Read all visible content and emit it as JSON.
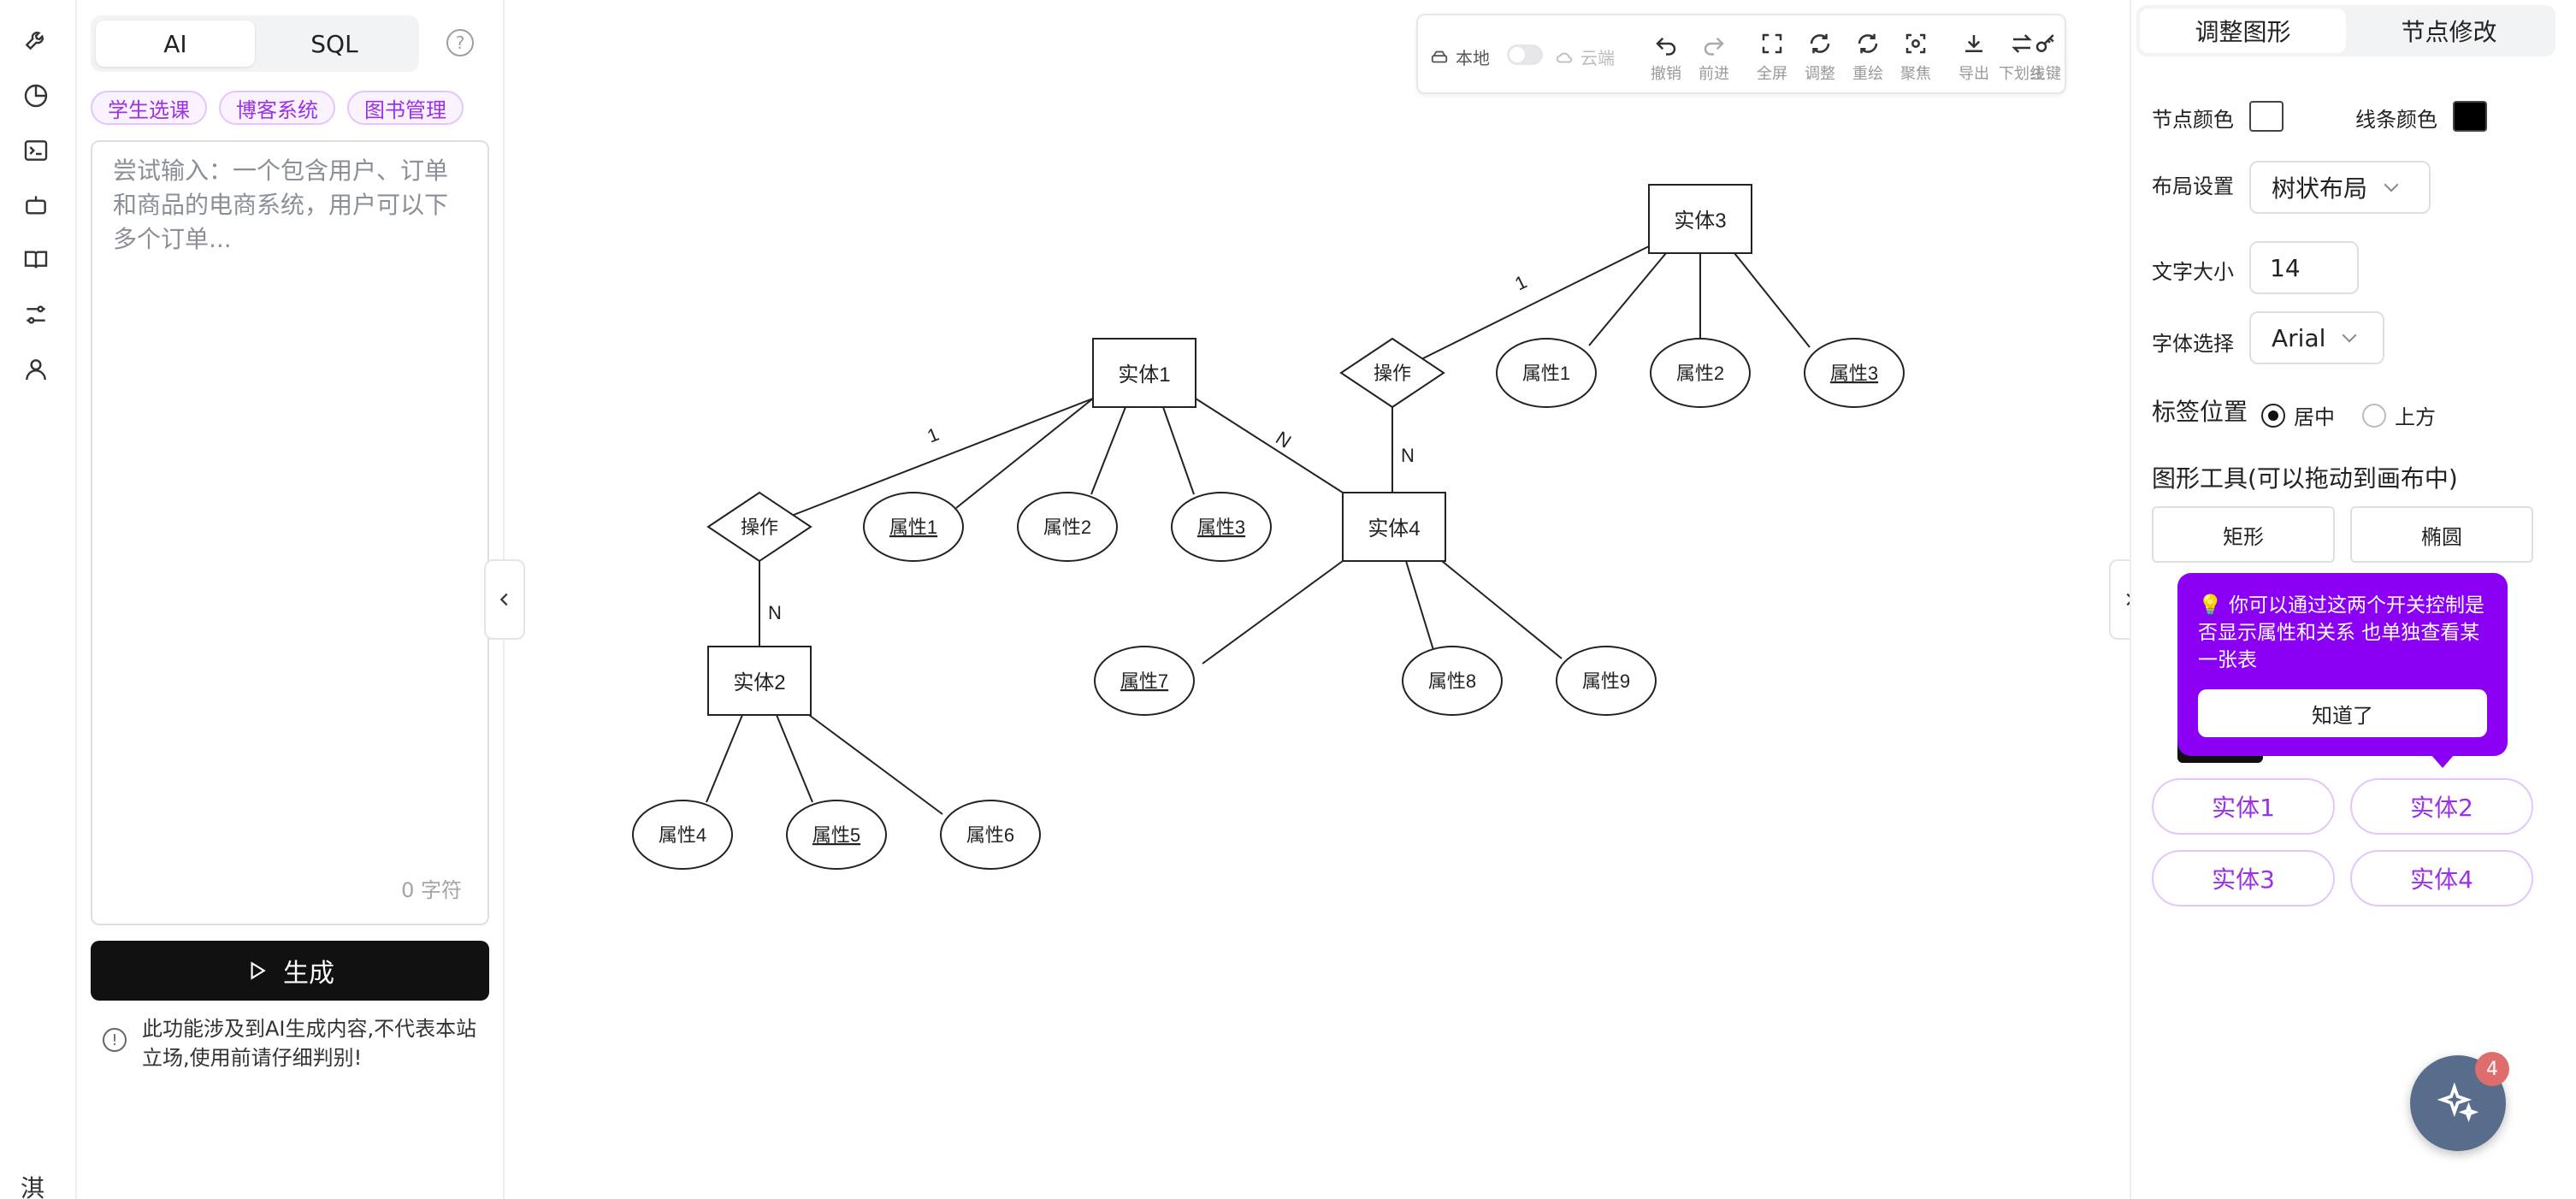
{
  "left_panel": {
    "mode_tabs": [
      {
        "label": "AI",
        "active": true
      },
      {
        "label": "SQL",
        "active": false
      }
    ],
    "help_icon": "question-circle-icon",
    "example_tags": [
      "学生选课",
      "博客系统",
      "图书管理"
    ],
    "prompt_input": {
      "value": "",
      "placeholder": "尝试输入：一个包含用户、订单和商品的电商系统，用户可以下多个订单..."
    },
    "char_count": "0 字符",
    "generate_button": "生成",
    "disclaimer": "此功能涉及到AI生成内容,不代表本站立场,使用前请仔细判别!"
  },
  "rail": {
    "icons": [
      "wrench-icon",
      "pie-chart-icon",
      "terminal-icon",
      "robot-icon",
      "book-icon",
      "settings-sliders-icon",
      "user-icon"
    ],
    "brand_char": "淇"
  },
  "toolbar": {
    "local_label": "本地",
    "cloud_label": "云端",
    "buttons": [
      {
        "label": "撤销",
        "icon": "undo-icon"
      },
      {
        "label": "前进",
        "icon": "redo-icon"
      },
      {
        "label": "全屏",
        "icon": "fullscreen-icon"
      },
      {
        "label": "调整",
        "icon": "refresh-icon"
      },
      {
        "label": "重绘",
        "icon": "redraw-icon"
      },
      {
        "label": "聚焦",
        "icon": "focus-icon"
      },
      {
        "label": "导出",
        "icon": "download-icon"
      },
      {
        "label": "下划线",
        "icon": "swap-icon"
      },
      {
        "label": "主键",
        "icon": "key-icon"
      }
    ]
  },
  "diagram": {
    "entities": [
      {
        "id": "e1",
        "label": "实体1"
      },
      {
        "id": "e2",
        "label": "实体2"
      },
      {
        "id": "e3",
        "label": "实体3"
      },
      {
        "id": "e4",
        "label": "实体4"
      }
    ],
    "relationships": [
      {
        "id": "r1",
        "label": "操作"
      },
      {
        "id": "r2",
        "label": "操作"
      }
    ],
    "attributes": [
      {
        "id": "a1_1",
        "label": "属性1",
        "key": true
      },
      {
        "id": "a1_2",
        "label": "属性2",
        "key": false
      },
      {
        "id": "a1_3",
        "label": "属性3",
        "key": true
      },
      {
        "id": "a2_4",
        "label": "属性4",
        "key": false
      },
      {
        "id": "a2_5",
        "label": "属性5",
        "key": true
      },
      {
        "id": "a2_6",
        "label": "属性6",
        "key": false
      },
      {
        "id": "a3_1",
        "label": "属性1",
        "key": false
      },
      {
        "id": "a3_2",
        "label": "属性2",
        "key": false
      },
      {
        "id": "a3_3",
        "label": "属性3",
        "key": true
      },
      {
        "id": "a4_7",
        "label": "属性7",
        "key": true
      },
      {
        "id": "a4_8",
        "label": "属性8",
        "key": false
      },
      {
        "id": "a4_9",
        "label": "属性9",
        "key": false
      }
    ],
    "cardinalities": [
      {
        "between": "e1-r1",
        "label": "1"
      },
      {
        "between": "r1-e2",
        "label": "N"
      },
      {
        "between": "e1-e4",
        "label": "N"
      },
      {
        "between": "e3-r2",
        "label": "1"
      },
      {
        "between": "r2-e4",
        "label": "N"
      }
    ]
  },
  "right_panel": {
    "tabs": [
      {
        "label": "调整图形",
        "active": true
      },
      {
        "label": "节点修改",
        "active": false
      }
    ],
    "node_color_label": "节点颜色",
    "node_color": "#ffffff",
    "line_color_label": "线条颜色",
    "line_color": "#000000",
    "layout_label": "布局设置",
    "layout_value": "树状布局",
    "font_size_label": "文字大小",
    "font_size_value": "14",
    "font_label": "字体选择",
    "font_value": "Arial",
    "label_position_label": "标签位置",
    "label_positions": [
      {
        "label": "居中",
        "checked": true
      },
      {
        "label": "上方",
        "checked": false
      }
    ],
    "shape_tools_title": "图形工具(可以拖动到画布中)",
    "shape_tools": [
      "矩形",
      "椭圆"
    ],
    "tooltip": {
      "message": "你可以通过这两个开关控制是否显示属性和关系 也单独查看某一张表",
      "button": "知道了"
    },
    "entity_filters": [
      "实体1",
      "实体2",
      "实体3",
      "实体4"
    ]
  },
  "fab": {
    "badge": "4",
    "icon": "sparkle-icon"
  },
  "colors": {
    "accent_purple": "#9b30e6",
    "tooltip_bg": "#8b00f5",
    "fab_bg": "#586c8c"
  }
}
